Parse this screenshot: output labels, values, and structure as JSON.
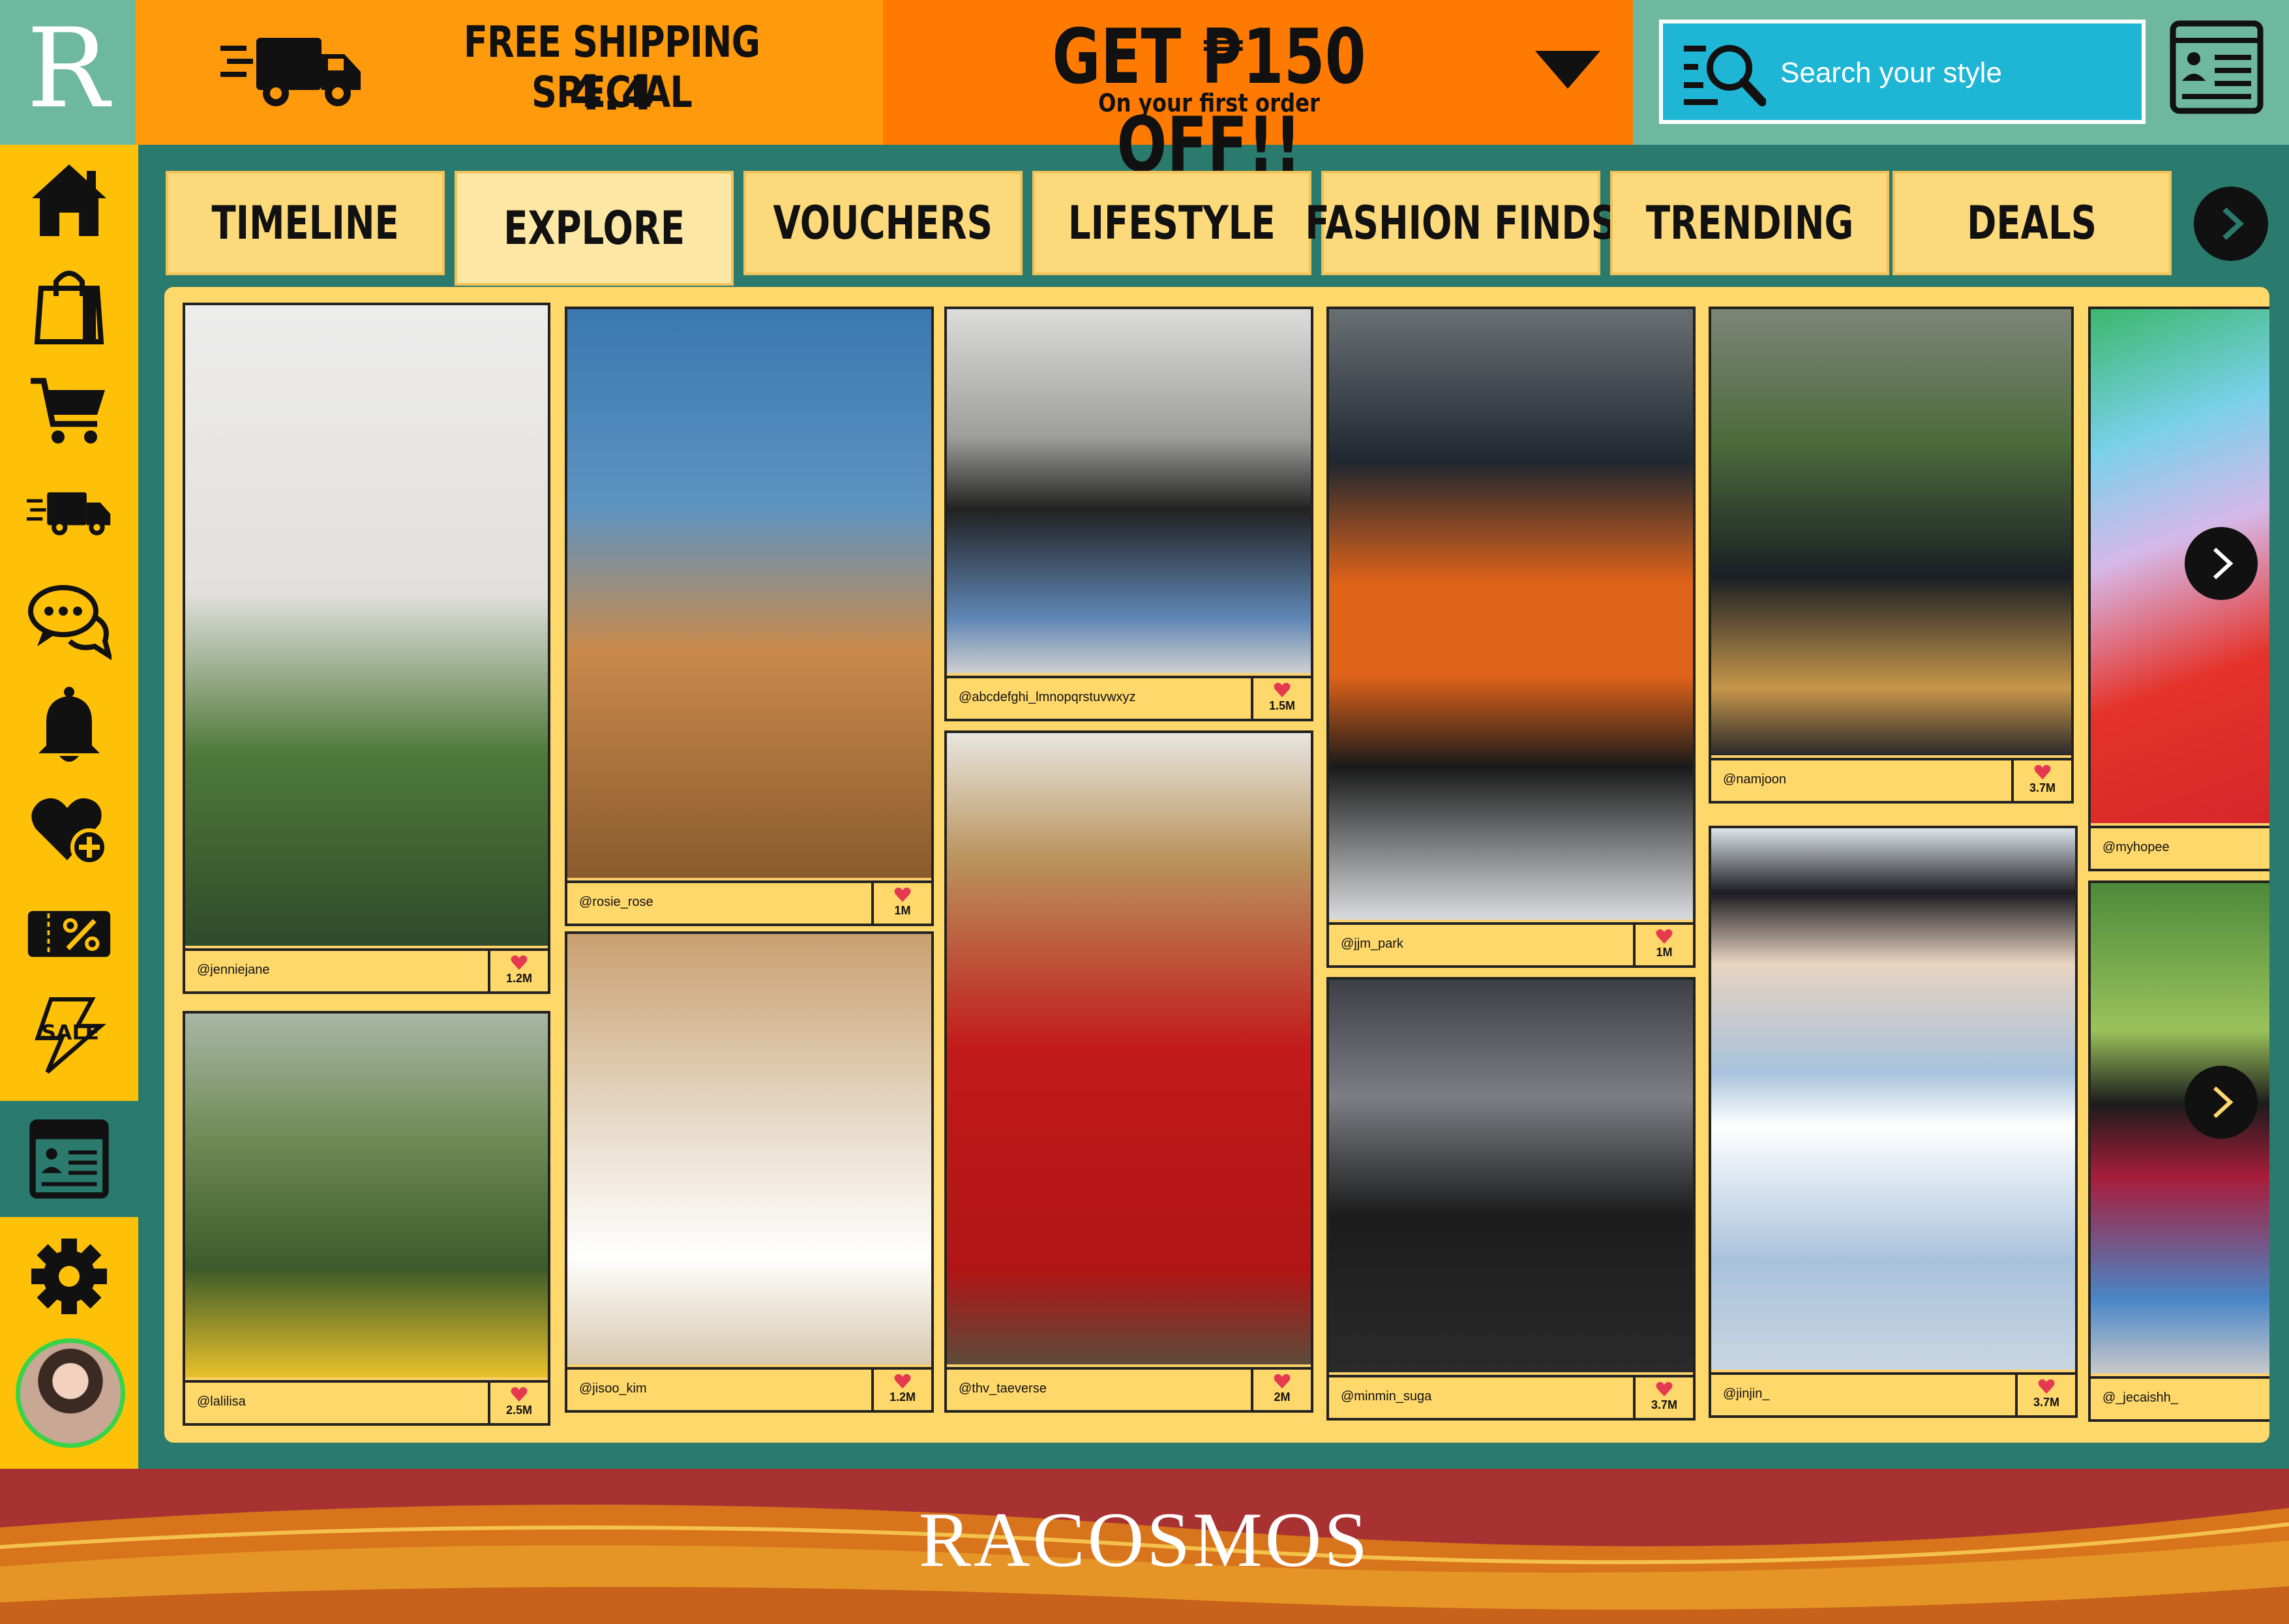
{
  "app": {
    "logo_letter": "R",
    "brand_footer": "RACOSMOS"
  },
  "promo_shipping": {
    "title": "FREE SHIPPING SPECIAL",
    "date": "4.4",
    "icon": "delivery-truck-icon"
  },
  "promo_discount": {
    "title": "GET ₱150 OFF!!",
    "subtitle": "On your first order",
    "icon": "chevron-down-icon"
  },
  "search": {
    "placeholder": "Search your style",
    "icon": "search-list-icon"
  },
  "header_icons": [
    "profile-list-icon"
  ],
  "sidebar": {
    "items": [
      {
        "id": "home",
        "icon": "home-icon"
      },
      {
        "id": "shop",
        "icon": "shopping-bag-icon"
      },
      {
        "id": "cart",
        "icon": "cart-icon"
      },
      {
        "id": "delivery",
        "icon": "delivery-truck-icon"
      },
      {
        "id": "chat",
        "icon": "chat-icon"
      },
      {
        "id": "notifications",
        "icon": "bell-icon"
      },
      {
        "id": "wishlist",
        "icon": "heart-plus-icon"
      },
      {
        "id": "vouchers",
        "icon": "voucher-icon"
      },
      {
        "id": "sale",
        "icon": "sale-icon"
      },
      {
        "id": "profile",
        "icon": "profile-list-icon",
        "active": true
      },
      {
        "id": "settings",
        "icon": "gear-icon"
      }
    ]
  },
  "tabs": [
    {
      "label": "TIMELINE"
    },
    {
      "label": "EXPLORE",
      "active": true
    },
    {
      "label": "VOUCHERS"
    },
    {
      "label": "LIFESTYLE"
    },
    {
      "label": "FASHION FINDS"
    },
    {
      "label": "TRENDING"
    },
    {
      "label": "DEALS"
    }
  ],
  "posts": [
    {
      "handle": "@jenniejane",
      "likes": "1.2M"
    },
    {
      "handle": "@lalilisa",
      "likes": "2.5M"
    },
    {
      "handle": "@rosie_rose",
      "likes": "1M"
    },
    {
      "handle": "@jisoo_kim",
      "likes": "1.2M"
    },
    {
      "handle": "@abcdefghi_lmnopqrstuvwxyz",
      "likes": "1.5M"
    },
    {
      "handle": "@thv_taeverse",
      "likes": "2M"
    },
    {
      "handle": "@jjm_park",
      "likes": "1M"
    },
    {
      "handle": "@minmin_suga",
      "likes": "3.7M"
    },
    {
      "handle": "@namjoon",
      "likes": "3.7M"
    },
    {
      "handle": "@jinjin_",
      "likes": "3.7M"
    },
    {
      "handle": "@myhopee",
      "likes": ""
    },
    {
      "handle": "@_jecaishh_",
      "likes": ""
    }
  ],
  "colors": {
    "teal_bg": "#2a7a6d",
    "sidebar_yellow": "#ffc107",
    "promo_orange": "#ff9a0c",
    "promo_deep_orange": "#ff7a00",
    "search_cyan": "#1fb6d6",
    "tab_yellow": "#fcd97a",
    "panel_yellow": "#ffd86b",
    "footer_red": "#a83232",
    "like_red": "#e53950"
  }
}
